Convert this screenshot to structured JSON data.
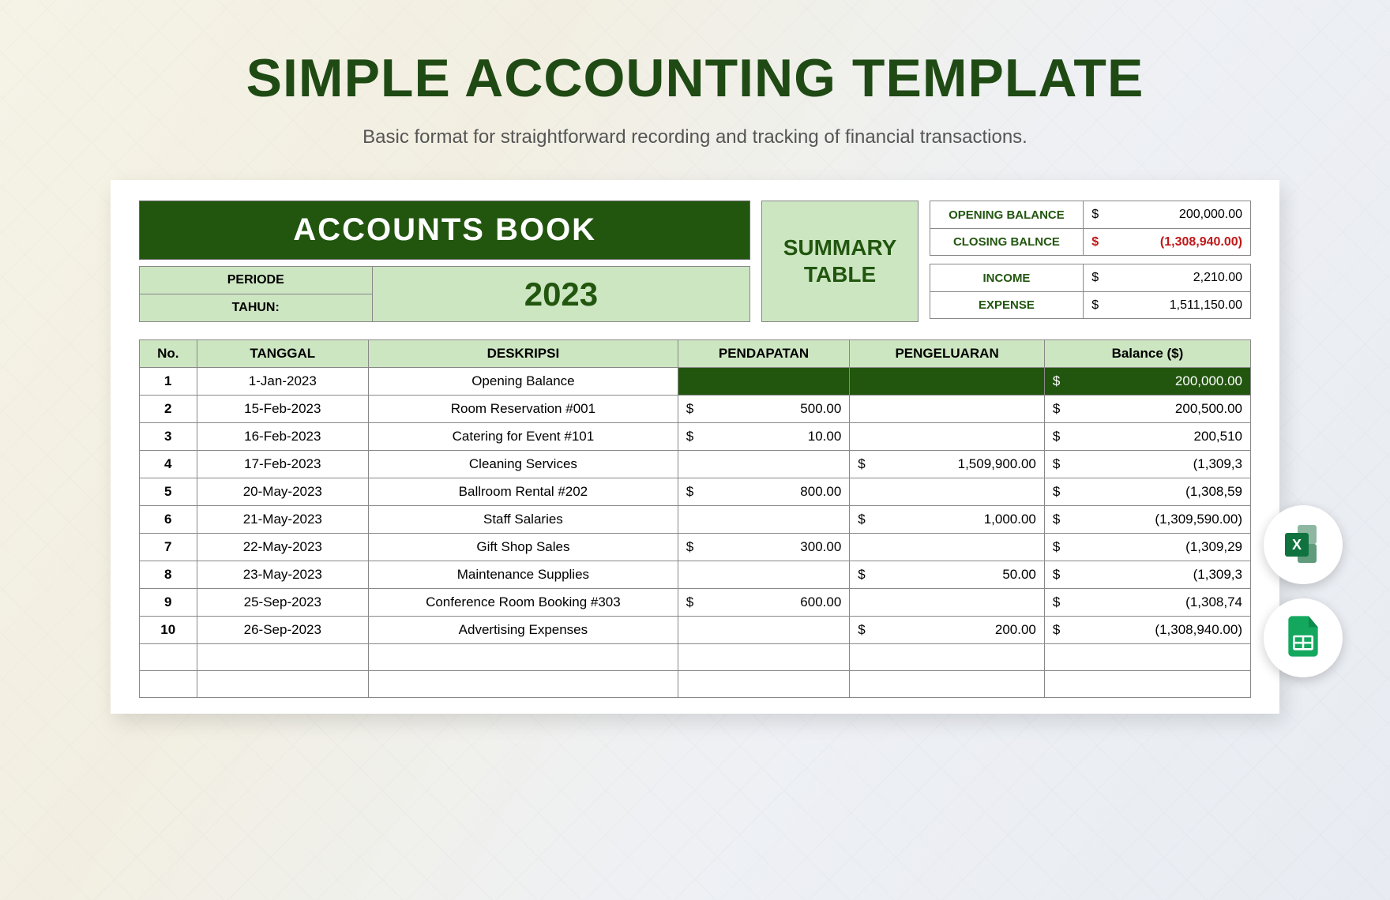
{
  "title": "SIMPLE ACCOUNTING TEMPLATE",
  "subtitle": "Basic format for straightforward recording and tracking of financial transactions.",
  "book": {
    "heading": "ACCOUNTS BOOK",
    "periode_label": "PERIODE",
    "tahun_label": "TAHUN:",
    "year": "2023"
  },
  "summary": {
    "label": "SUMMARY TABLE",
    "rows": [
      {
        "k": "OPENING BALANCE",
        "v": "200,000.00",
        "red": false
      },
      {
        "k": "CLOSING BALNCE",
        "v": "(1,308,940.00)",
        "red": true
      }
    ],
    "rows2": [
      {
        "k": "INCOME",
        "v": "2,210.00"
      },
      {
        "k": "EXPENSE",
        "v": "1,511,150.00"
      }
    ]
  },
  "ledger": {
    "headers": {
      "no": "No.",
      "tanggal": "TANGGAL",
      "deskripsi": "DESKRIPSI",
      "pendapatan": "PENDAPATAN",
      "pengeluaran": "PENGELUARAN",
      "balance": "Balance ($)"
    },
    "rows": [
      {
        "n": "1",
        "t": "1-Jan-2023",
        "d": "Opening Balance",
        "pd": "",
        "pg": "",
        "b": "200,000.00",
        "first": true
      },
      {
        "n": "2",
        "t": "15-Feb-2023",
        "d": "Room Reservation #001",
        "pd": "500.00",
        "pg": "",
        "b": "200,500.00"
      },
      {
        "n": "3",
        "t": "16-Feb-2023",
        "d": "Catering for Event #101",
        "pd": "10.00",
        "pg": "",
        "b": "200,510"
      },
      {
        "n": "4",
        "t": "17-Feb-2023",
        "d": "Cleaning Services",
        "pd": "",
        "pg": "1,509,900.00",
        "b": "(1,309,3"
      },
      {
        "n": "5",
        "t": "20-May-2023",
        "d": "Ballroom Rental #202",
        "pd": "800.00",
        "pg": "",
        "b": "(1,308,59"
      },
      {
        "n": "6",
        "t": "21-May-2023",
        "d": "Staff Salaries",
        "pd": "",
        "pg": "1,000.00",
        "b": "(1,309,590.00)"
      },
      {
        "n": "7",
        "t": "22-May-2023",
        "d": "Gift Shop Sales",
        "pd": "300.00",
        "pg": "",
        "b": "(1,309,29"
      },
      {
        "n": "8",
        "t": "23-May-2023",
        "d": "Maintenance Supplies",
        "pd": "",
        "pg": "50.00",
        "b": "(1,309,3"
      },
      {
        "n": "9",
        "t": "25-Sep-2023",
        "d": "Conference Room Booking #303",
        "pd": "600.00",
        "pg": "",
        "b": "(1,308,74"
      },
      {
        "n": "10",
        "t": "26-Sep-2023",
        "d": "Advertising Expenses",
        "pd": "",
        "pg": "200.00",
        "b": "(1,308,940.00)"
      }
    ],
    "empty_rows": 2
  },
  "badges": {
    "excel": "X"
  }
}
